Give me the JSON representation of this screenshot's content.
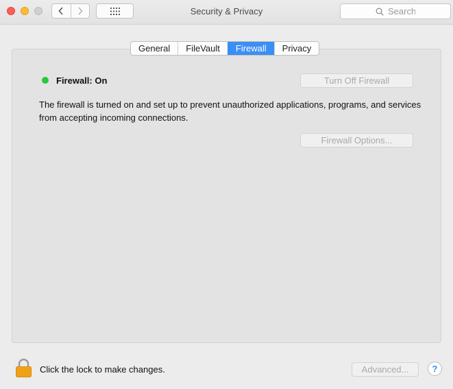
{
  "window": {
    "title": "Security & Privacy",
    "search_placeholder": "Search"
  },
  "toolbar": {
    "back_icon": "chevron-left-icon",
    "forward_icon": "chevron-right-icon",
    "show_all_icon": "grid-icon",
    "search_icon": "magnifier-icon"
  },
  "tabs": [
    {
      "label": "General",
      "active": false
    },
    {
      "label": "FileVault",
      "active": false
    },
    {
      "label": "Firewall",
      "active": true
    },
    {
      "label": "Privacy",
      "active": false
    }
  ],
  "firewall": {
    "status_label": "Firewall: On",
    "status_color": "#28c940",
    "turn_off_label": "Turn Off Firewall",
    "description": "The firewall is turned on and set up to prevent unauthorized applications, programs, and services from accepting incoming connections.",
    "options_label": "Firewall Options..."
  },
  "footer": {
    "lock_label": "Click the lock to make changes.",
    "advanced_label": "Advanced...",
    "help_label": "?"
  },
  "colors": {
    "accent": "#3b8ef4",
    "close": "#fd5f57",
    "minimize": "#febc2e",
    "zoom_disabled": "#d0d0d0",
    "lock": "#f2a51a"
  }
}
